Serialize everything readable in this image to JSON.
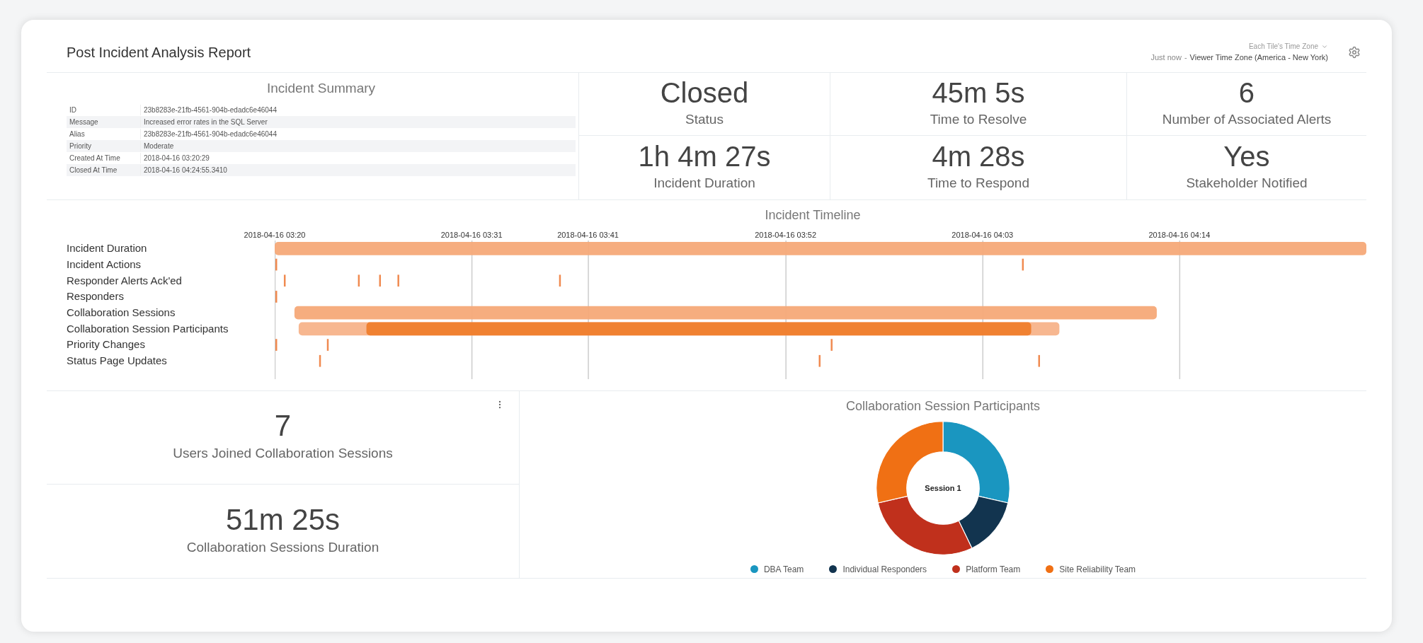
{
  "header": {
    "title": "Post Incident Analysis Report",
    "timezone_menu": "Each Tile's Time Zone",
    "refreshed": "Just now",
    "separator": "-",
    "timezone": "Viewer Time Zone (America - New York)"
  },
  "incident_summary": {
    "title": "Incident Summary",
    "rows": [
      {
        "label": "ID",
        "value": "23b8283e-21fb-4561-904b-edadc6e46044"
      },
      {
        "label": "Message",
        "value": "Increased error rates in the SQL Server"
      },
      {
        "label": "Alias",
        "value": "23b8283e-21fb-4561-904b-edadc6e46044"
      },
      {
        "label": "Priority",
        "value": "Moderate"
      },
      {
        "label": "Created At Time",
        "value": "2018-04-16 03:20:29"
      },
      {
        "label": "Closed At Time",
        "value": "2018-04-16 04:24:55.3410"
      }
    ]
  },
  "kpis": [
    {
      "value": "Closed",
      "label": "Status"
    },
    {
      "value": "45m 5s",
      "label": "Time to Resolve"
    },
    {
      "value": "6",
      "label": "Number of Associated Alerts"
    },
    {
      "value": "1h 4m 27s",
      "label": "Incident Duration"
    },
    {
      "value": "4m 28s",
      "label": "Time to Respond"
    },
    {
      "value": "Yes",
      "label": "Stakeholder Notified"
    }
  ],
  "timeline": {
    "title": "Incident Timeline",
    "ticks": [
      "2018-04-16 03:20",
      "2018-04-16 03:31",
      "2018-04-16 03:41",
      "2018-04-16 03:52",
      "2018-04-16 04:03",
      "2018-04-16 04:14"
    ],
    "rows": [
      "Incident Duration",
      "Incident Actions",
      "Responder Alerts Ack'ed",
      "Responders",
      "Collaboration Sessions",
      "Collaboration Session Participants",
      "Priority Changes",
      "Status Page Updates"
    ]
  },
  "bottom_kpis": [
    {
      "value": "7",
      "label": "Users Joined Collaboration Sessions"
    },
    {
      "value": "51m 25s",
      "label": "Collaboration Sessions Duration"
    }
  ],
  "participants_chart": {
    "title": "Collaboration Session Participants",
    "chart_data": {
      "type": "donut",
      "legend": "bottom",
      "categories": [
        "DBA Team",
        "Individual Responders",
        "Platform Team",
        "Site Reliability Team"
      ],
      "series": [
        {
          "name": "Session 1",
          "colors": [
            "#1a96c0",
            "#12344f",
            "#c0301c",
            "#f07014"
          ],
          "values": [
            28.57,
            14.29,
            28.57,
            28.57
          ]
        }
      ]
    }
  }
}
